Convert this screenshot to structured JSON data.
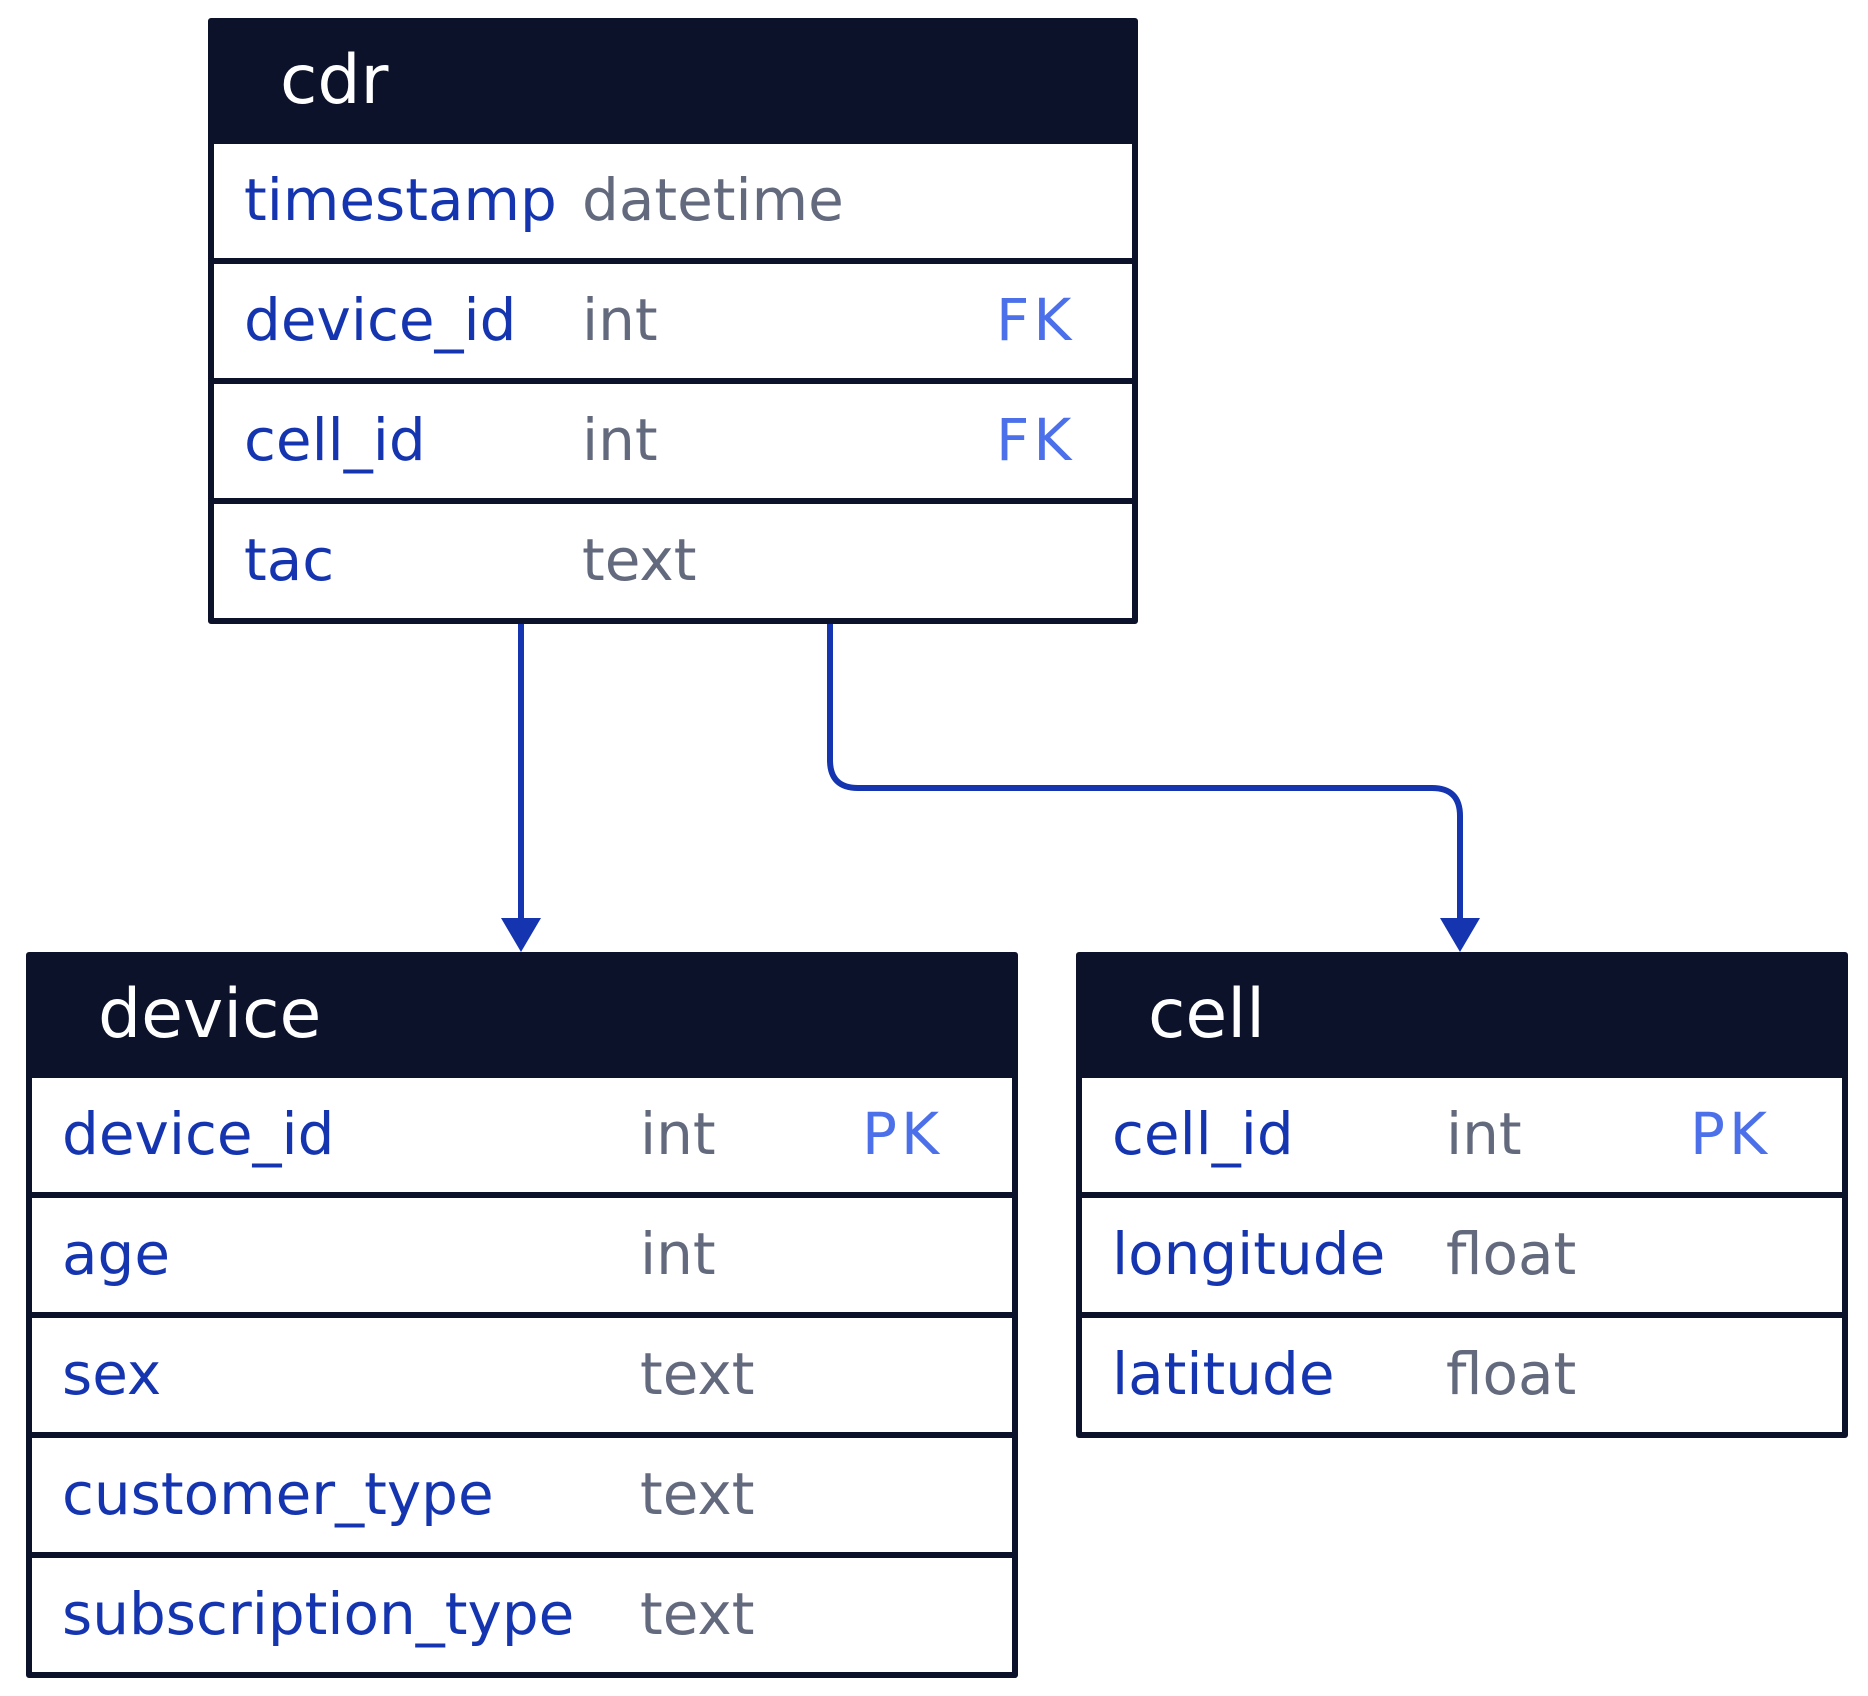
{
  "diagram": {
    "type": "entity-relationship",
    "colors": {
      "header_bg": "#0c1229",
      "header_text": "#ffffff",
      "field_name": "#1535b0",
      "field_type": "#636a7d",
      "key_label": "#4b70ea",
      "connector": "#1535b0"
    },
    "tables": {
      "cdr": {
        "title": "cdr",
        "fields": [
          {
            "name": "timestamp",
            "type": "datetime",
            "key": ""
          },
          {
            "name": "device_id",
            "type": "int",
            "key": "FK"
          },
          {
            "name": "cell_id",
            "type": "int",
            "key": "FK"
          },
          {
            "name": "tac",
            "type": "text",
            "key": ""
          }
        ]
      },
      "device": {
        "title": "device",
        "fields": [
          {
            "name": "device_id",
            "type": "int",
            "key": "PK"
          },
          {
            "name": "age",
            "type": "int",
            "key": ""
          },
          {
            "name": "sex",
            "type": "text",
            "key": ""
          },
          {
            "name": "customer_type",
            "type": "text",
            "key": ""
          },
          {
            "name": "subscription_type",
            "type": "text",
            "key": ""
          }
        ]
      },
      "cell": {
        "title": "cell",
        "fields": [
          {
            "name": "cell_id",
            "type": "int",
            "key": "PK"
          },
          {
            "name": "longitude",
            "type": "float",
            "key": ""
          },
          {
            "name": "latitude",
            "type": "float",
            "key": ""
          }
        ]
      }
    },
    "relationships": [
      {
        "from": "cdr.device_id",
        "to": "device.device_id"
      },
      {
        "from": "cdr.cell_id",
        "to": "cell.cell_id"
      }
    ]
  }
}
